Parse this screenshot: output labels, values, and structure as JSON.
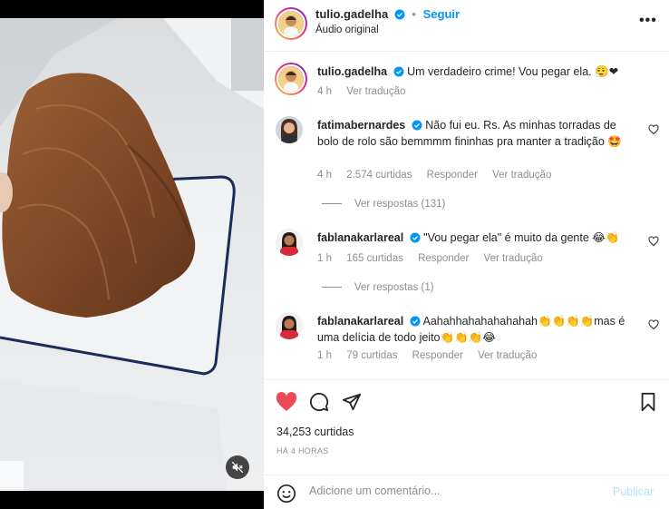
{
  "post": {
    "username": "tulio.gadelha",
    "follow_label": "Seguir",
    "audio": "Áudio original",
    "more": "•••"
  },
  "caption": {
    "username": "tulio.gadelha",
    "text": "Um verdadeiro crime! Vou pegar ela. 😮‍💨❤",
    "age": "4 h",
    "translate": "Ver tradução"
  },
  "comments": [
    {
      "username": "fatimabernardes",
      "text": "Não fui eu. Rs. As minhas torradas de bolo de rolo são bemmmm fininhas pra manter a tradição 🤩",
      "age": "4 h",
      "likes": "2.574 curtidas",
      "reply": "Responder",
      "translate": "Ver tradução",
      "view_replies": "Ver respostas (131)"
    },
    {
      "username": "fablanakarlareal",
      "text": "\"Vou pegar ela\" é muito da gente 😂👏",
      "age": "1 h",
      "likes": "165 curtidas",
      "reply": "Responder",
      "translate": "Ver tradução",
      "view_replies": "Ver respostas (1)"
    },
    {
      "username": "fablanakarlareal",
      "text": "Aahahhahahahahahah👏👏👏👏mas é uma delícia de todo jeito👏👏👏😂",
      "age": "1 h",
      "likes": "79 curtidas",
      "reply": "Responder",
      "translate": "Ver tradução"
    }
  ],
  "engagement": {
    "likes": "34,253 curtidas",
    "posted": "HÁ 4 HORAS"
  },
  "add_comment": {
    "placeholder": "Adicione um comentário...",
    "publish": "Publicar"
  },
  "icons": {
    "like": "heart-icon",
    "comment": "comment-icon",
    "share": "send-icon",
    "save": "bookmark-icon",
    "mute": "muted-speaker-icon",
    "emoji": "smiley-icon",
    "verified": "verified-badge-icon"
  },
  "colors": {
    "verified": "#0095f6",
    "liked": "#ed4956",
    "link": "#0095f6",
    "publish_disabled": "#b2dffc"
  }
}
